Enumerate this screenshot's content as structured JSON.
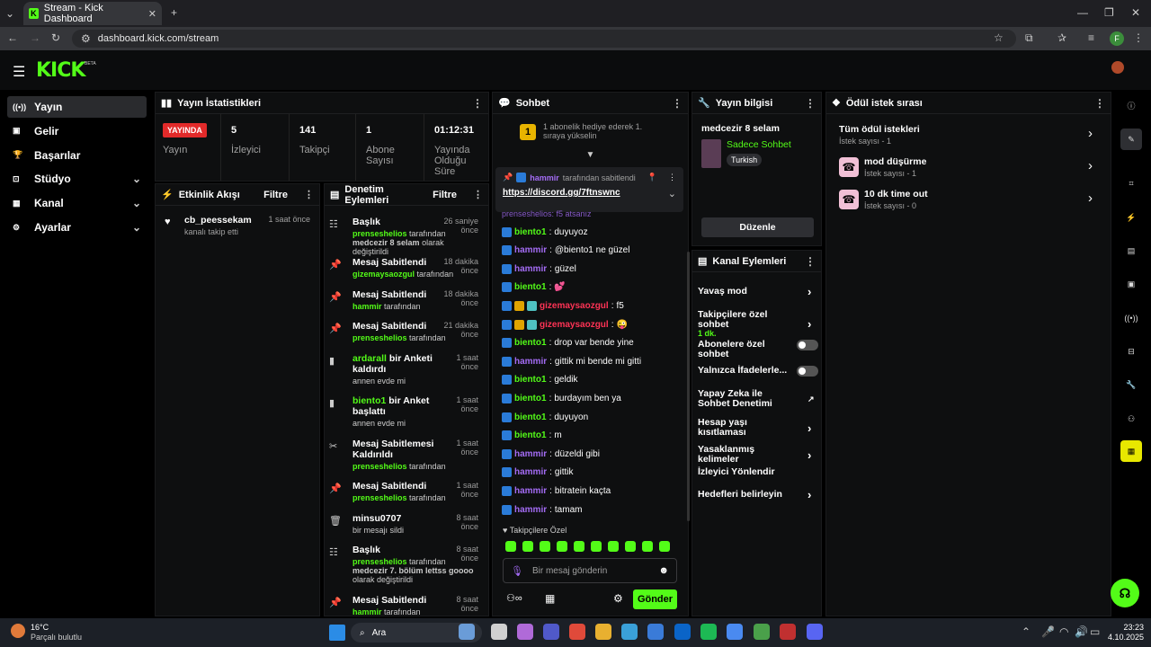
{
  "browser": {
    "tab_title": "Stream - Kick Dashboard",
    "url": "dashboard.kick.com/stream",
    "profile_letter": "F"
  },
  "brand": {
    "logo": "KICK",
    "beta": "BETA",
    "accent": "#53fc18"
  },
  "nav": [
    {
      "label": "Yayın",
      "icon": "broadcast-icon",
      "active": true
    },
    {
      "label": "Gelir",
      "icon": "revenue-icon"
    },
    {
      "label": "Başarılar",
      "icon": "trophy-icon"
    },
    {
      "label": "Stüdyo",
      "icon": "studio-icon",
      "expand": true
    },
    {
      "label": "Kanal",
      "icon": "channel-icon",
      "expand": true
    },
    {
      "label": "Ayarlar",
      "icon": "gear-icon",
      "expand": true
    }
  ],
  "stats": {
    "title": "Yayın İstatistikleri",
    "live_badge": "YAYINDA",
    "live_label": "Yayın",
    "viewers_value": "5",
    "viewers_label": "İzleyici",
    "followers_value": "141",
    "followers_label": "Takipçi",
    "subs_value": "1",
    "subs_label": "Abone Sayısı",
    "duration_value": "01:12:31",
    "duration_label": "Yayında Olduğu Süre"
  },
  "activity": {
    "title": "Etkinlik Akışı",
    "filter": "Filtre",
    "item_user": "cb_peessekam",
    "item_time": "1 saat önce",
    "item_text": "kanalı takip etti"
  },
  "modlog": {
    "title": "Denetim Eylemleri",
    "filter": "Filtre",
    "items": [
      {
        "title": "Başlık",
        "time": "26 saniye önce",
        "sub_user": "prenseshelios",
        "sub_text": "tarafından",
        "sub_extra": "medcezir 8 selam",
        "sub_tail": "olarak değiştirildi"
      },
      {
        "title": "Mesaj Sabitlendi",
        "time": "18 dakika önce",
        "sub_user": "gizemaysaozgul",
        "sub_text": "tarafından"
      },
      {
        "title": "Mesaj Sabitlendi",
        "time": "18 dakika önce",
        "sub_user": "hammir",
        "sub_text": "tarafından"
      },
      {
        "title": "Mesaj Sabitlendi",
        "time": "21 dakika önce",
        "sub_user": "prenseshelios",
        "sub_text": "tarafından"
      },
      {
        "title_user": "ardarall",
        "title": "bir Anketi kaldırdı",
        "time": "1 saat önce",
        "sub_text": "annen evde mi"
      },
      {
        "title_user": "biento1",
        "title": "bir Anket başlattı",
        "time": "1 saat önce",
        "sub_text": "annen evde mi"
      },
      {
        "title": "Mesaj Sabitlemesi Kaldırıldı",
        "time": "1 saat önce",
        "sub_user": "prenseshelios",
        "sub_text": "tarafından"
      },
      {
        "title": "Mesaj Sabitlendi",
        "time": "1 saat önce",
        "sub_user": "prenseshelios",
        "sub_text": "tarafından"
      },
      {
        "title": "minsu0707",
        "time": "8 saat önce",
        "sub_text": "bir mesajı sildi"
      },
      {
        "title": "Başlık",
        "time": "8 saat önce",
        "sub_user": "prenseshelios",
        "sub_text": "tarafından",
        "sub_extra": "medcezir 7. bölüm lettss goooo",
        "sub_tail": "olarak değiştirildi"
      },
      {
        "title": "Mesaj Sabitlendi",
        "time": "8 saat önce",
        "sub_user": "hammir",
        "sub_text": "tarafından"
      }
    ]
  },
  "chat": {
    "title": "Sohbet",
    "gift_rank": "1",
    "gift_text": "1 abonelik hediye ederek 1. sıraya yükselin",
    "pinned_by_user": "hammir",
    "pinned_by_text": "tarafından sabitlendi",
    "pinned_link": "https://discord.gg/7ftnswnc",
    "partial_line": "prenseshelios: f5 atsanız",
    "messages": [
      {
        "user": "biento1",
        "color": "b",
        "text": "duyuyoz"
      },
      {
        "user": "hammir",
        "color": "p",
        "text": "@biento1 ne güzel"
      },
      {
        "user": "hammir",
        "color": "p",
        "text": "güzel"
      },
      {
        "user": "biento1",
        "color": "b",
        "text": "💕"
      },
      {
        "user": "gizemaysaozgul",
        "color": "r",
        "text": "f5",
        "crown": true
      },
      {
        "user": "gizemaysaozgul",
        "color": "r",
        "text": "😜",
        "crown": true
      },
      {
        "user": "biento1",
        "color": "b",
        "text": "drop var bende yine"
      },
      {
        "user": "hammir",
        "color": "p",
        "text": "gittik mi bende mi gitti"
      },
      {
        "user": "biento1",
        "color": "b",
        "text": "geldik"
      },
      {
        "user": "biento1",
        "color": "b",
        "text": "burdayım ben ya"
      },
      {
        "user": "biento1",
        "color": "b",
        "text": "duyuyon"
      },
      {
        "user": "biento1",
        "color": "b",
        "text": "m"
      },
      {
        "user": "hammir",
        "color": "p",
        "text": "düzeldi gibi"
      },
      {
        "user": "hammir",
        "color": "p",
        "text": "gittik"
      },
      {
        "user": "hammir",
        "color": "p",
        "text": "bitratein kaçta"
      },
      {
        "user": "hammir",
        "color": "p",
        "text": "tamam"
      }
    ],
    "followers_only": "Takipçilere Özel",
    "input_placeholder": "Bir mesaj gönderin",
    "send": "Gönder"
  },
  "stream_info": {
    "title": "Yayın bilgisi",
    "stream_title": "medcezir 8 selam",
    "category": "Sadece Sohbet",
    "language": "Turkish",
    "edit": "Düzenle"
  },
  "channel_actions": {
    "title": "Kanal Eylemleri",
    "items": [
      {
        "label": "Yavaş mod",
        "type": "chevron"
      },
      {
        "label": "Takipçilere özel sohbet",
        "sub": "1 dk.",
        "type": "chevron"
      },
      {
        "label": "Abonelere özel sohbet",
        "type": "toggle"
      },
      {
        "label": "Yalnızca İfadelerle...",
        "type": "toggle"
      },
      {
        "label": "Yapay Zeka ile Sohbet Denetimi",
        "type": "external"
      },
      {
        "label": "Hesap yaşı kısıtlaması",
        "type": "chevron"
      },
      {
        "label": "Yasaklanmış kelimeler",
        "type": "chevron"
      },
      {
        "label": "İzleyici Yönlendir",
        "type": "none"
      },
      {
        "label": "Hedefleri belirleyin",
        "type": "chevron"
      }
    ]
  },
  "rewards": {
    "title": "Ödül istek sırası",
    "items": [
      {
        "label": "Tüm ödül istekleri",
        "count": "İstek sayısı - 1",
        "icon": false
      },
      {
        "label": "mod düşürme",
        "count": "İstek sayısı - 1",
        "icon": true
      },
      {
        "label": "10 dk time out",
        "count": "İstek sayısı - 0",
        "icon": true
      }
    ]
  },
  "taskbar": {
    "weather_temp": "16°C",
    "weather_text": "Parçalı bulutlu",
    "search": "Ara",
    "time": "23:23",
    "date": "4.10.2025"
  }
}
